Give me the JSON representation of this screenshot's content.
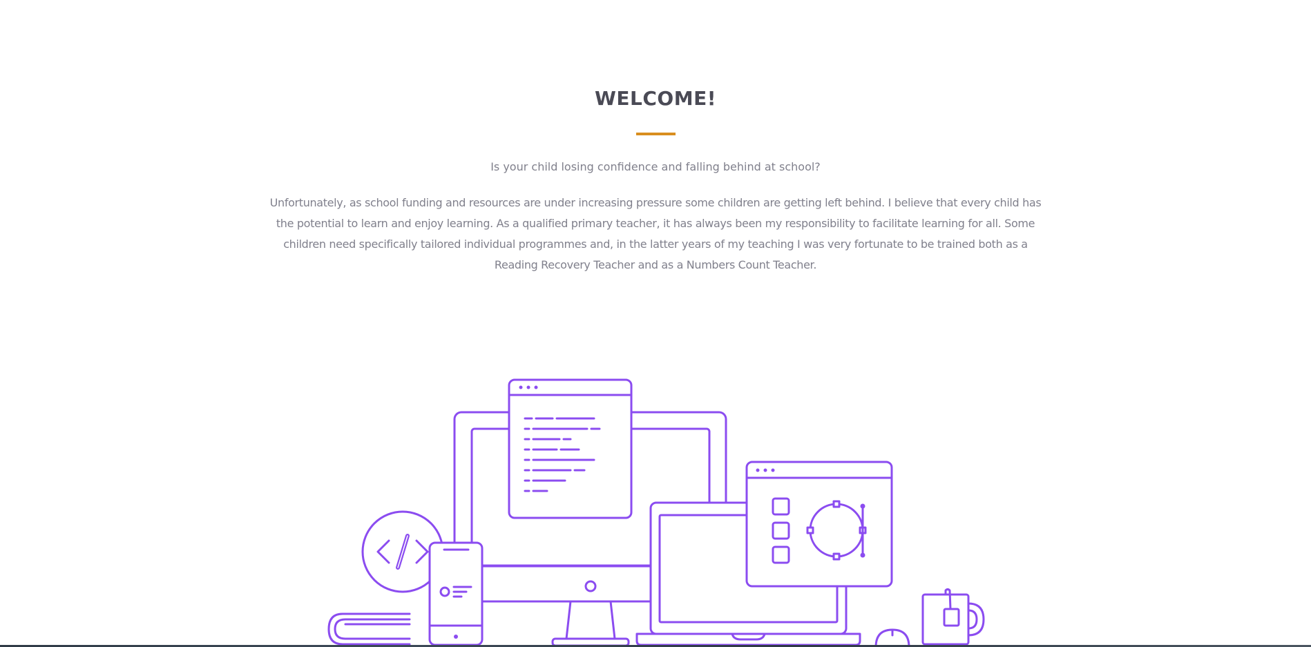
{
  "welcome": {
    "title": "WELCOME!",
    "lead": "Is your child losing confidence and falling behind at school?",
    "body": "Unfortunately, as school funding and resources are under increasing pressure some children are getting left behind. I believe that every child has the potential to learn and enjoy learning. As a qualified primary teacher, it has always been my responsibility to facilitate learning for all. Some children need specifically tailored individual programmes and, in the latter years of my teaching I was very fortunate to be trained both as a Reading Recovery Teacher and as a Numbers Count Teacher."
  },
  "illustration": {
    "icons": [
      "monitor-icon",
      "code-window-icon",
      "design-window-icon",
      "laptop-icon",
      "phone-icon",
      "code-badge-icon",
      "book-icon",
      "mug-icon",
      "mouse-icon"
    ]
  },
  "colors": {
    "title": "#4a4a55",
    "accent": "#d98e1f",
    "text": "#80808c",
    "illustration_stroke": "#8b4cf0"
  }
}
